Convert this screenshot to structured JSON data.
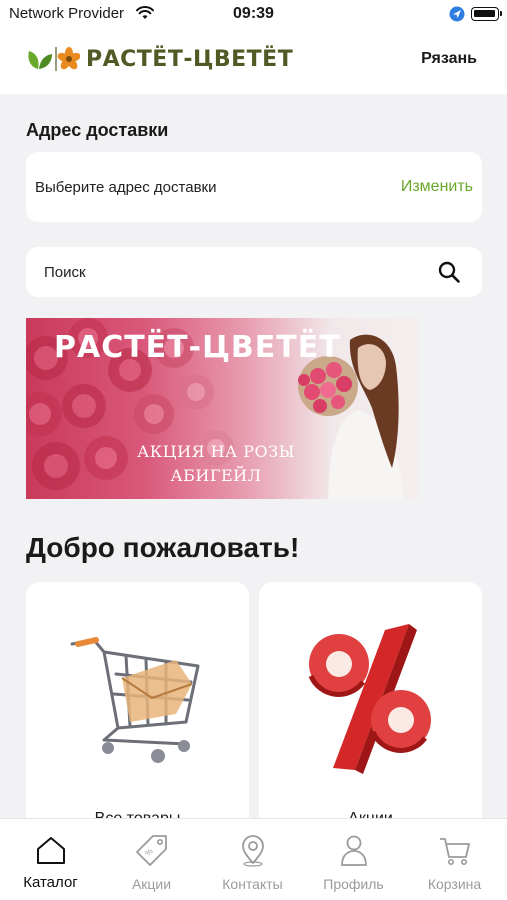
{
  "status_bar": {
    "carrier": "Network Provider",
    "time": "09:39"
  },
  "header": {
    "logo_text": "РАСТЁТ-ЦВЕТЁТ",
    "city": "Рязань"
  },
  "delivery": {
    "title": "Адрес доставки",
    "address_placeholder": "Выберите адрес доставки",
    "change_label": "Изменить"
  },
  "search": {
    "placeholder": "Поиск"
  },
  "banner": {
    "title": "РАСТЁТ-ЦВЕТЁТ",
    "promo_line1": "АКЦИЯ НА РОЗЫ",
    "promo_line2": "АБИГЕЙЛ"
  },
  "welcome_title": "Добро пожаловать!",
  "categories": [
    {
      "label": "Все товары",
      "icon": "shopping-cart-illustration"
    },
    {
      "label": "Акции",
      "icon": "percent-illustration"
    }
  ],
  "tabbar": [
    {
      "label": "Каталог",
      "icon": "home-icon",
      "active": true
    },
    {
      "label": "Акции",
      "icon": "tag-icon",
      "active": false
    },
    {
      "label": "Контакты",
      "icon": "map-pin-icon",
      "active": false
    },
    {
      "label": "Профиль",
      "icon": "user-icon",
      "active": false
    },
    {
      "label": "Корзина",
      "icon": "cart-icon",
      "active": false
    }
  ],
  "colors": {
    "accent_green": "#6aa82c",
    "logo_olive": "#4f5a24",
    "logo_orange": "#e98a1f",
    "background": "#f2f2f4"
  }
}
